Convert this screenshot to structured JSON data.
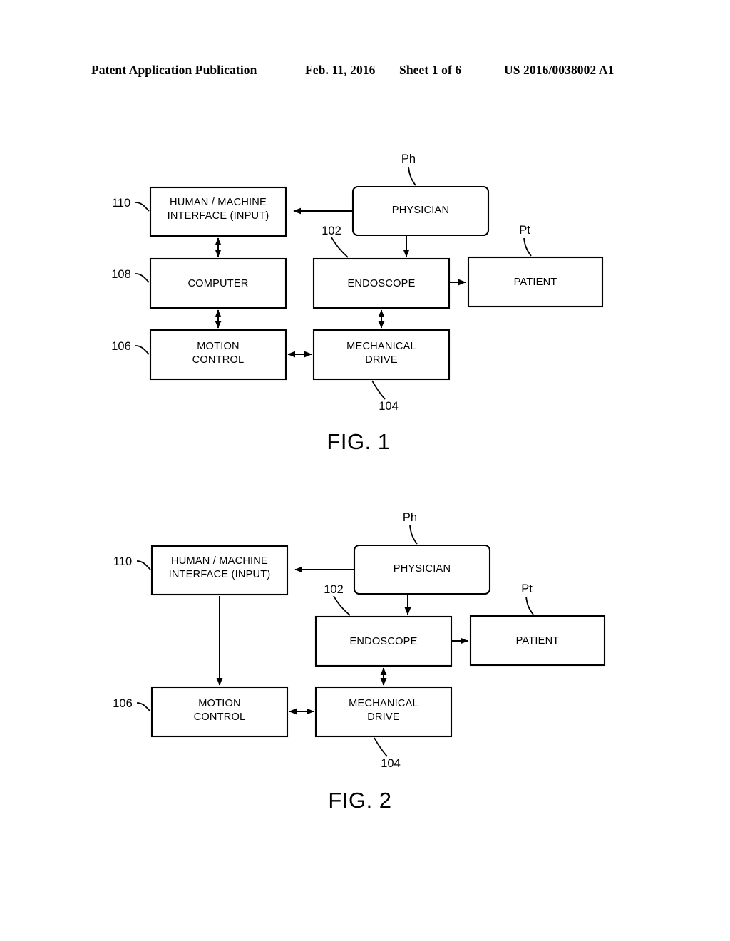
{
  "header": {
    "publication": "Patent Application Publication",
    "date": "Feb. 11, 2016",
    "sheet": "Sheet 1 of 6",
    "number": "US 2016/0038002 A1"
  },
  "figures": [
    {
      "id": "fig-1",
      "caption": "FIG. 1",
      "boxes": {
        "hmi": "HUMAN / MACHINE\nINTERFACE (INPUT)",
        "hmi_line1": "HUMAN / MACHINE",
        "hmi_line2": "INTERFACE (INPUT)",
        "physician": "PHYSICIAN",
        "computer": "COMPUTER",
        "endoscope": "ENDOSCOPE",
        "patient": "PATIENT",
        "motion_line1": "MOTION",
        "motion_line2": "CONTROL",
        "mech_line1": "MECHANICAL",
        "mech_line2": "DRIVE"
      },
      "refs": {
        "hmi": "110",
        "computer": "108",
        "motion": "106",
        "endoscope": "102",
        "mechanical": "104",
        "physician": "Ph",
        "patient": "Pt"
      }
    },
    {
      "id": "fig-2",
      "caption": "FIG. 2",
      "boxes": {
        "hmi_line1": "HUMAN / MACHINE",
        "hmi_line2": "INTERFACE (INPUT)",
        "physician": "PHYSICIAN",
        "endoscope": "ENDOSCOPE",
        "patient": "PATIENT",
        "motion_line1": "MOTION",
        "motion_line2": "CONTROL",
        "mech_line1": "MECHANICAL",
        "mech_line2": "DRIVE"
      },
      "refs": {
        "hmi": "110",
        "motion": "106",
        "endoscope": "102",
        "mechanical": "104",
        "physician": "Ph",
        "patient": "Pt"
      }
    }
  ]
}
